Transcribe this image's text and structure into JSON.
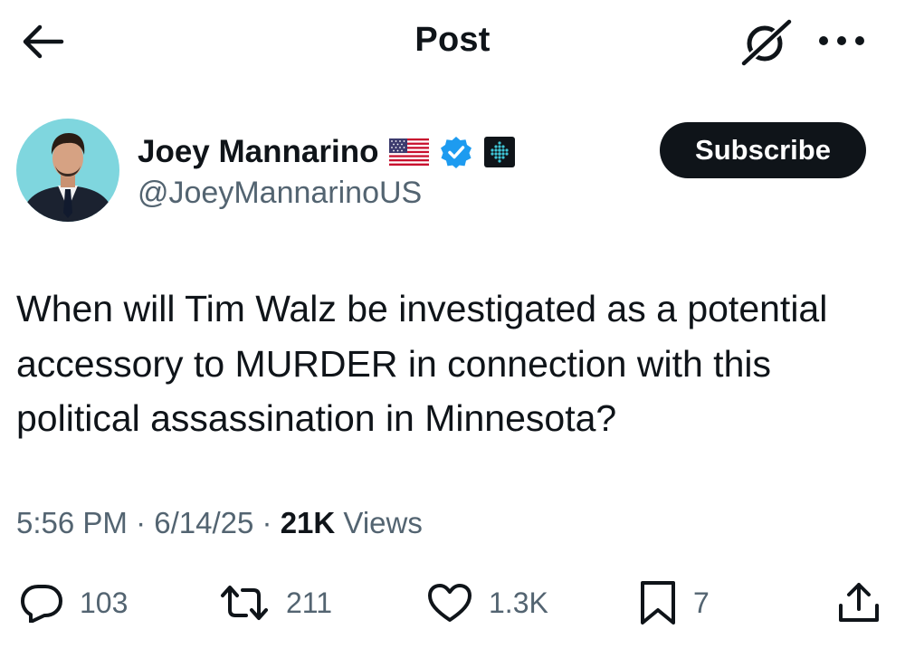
{
  "header": {
    "title": "Post",
    "back_icon": "arrow-left-icon",
    "grok_icon": "grok-icon",
    "more_icon": "more-horizontal-icon"
  },
  "author": {
    "name": "Joey Mannarino",
    "handle": "@JoeyMannarinoUS",
    "badges": [
      "us-flag-icon",
      "verified-badge-icon",
      "affiliate-badge-icon"
    ],
    "verified_color": "#1d9bf0"
  },
  "subscribe_label": "Subscribe",
  "tweet": {
    "text": "When will Tim Walz be investigated as a potential accessory to MURDER in connection with this political assassination in Minnesota?"
  },
  "meta": {
    "time": "5:56 PM",
    "separator": "·",
    "date": "6/14/25",
    "views_count": "21K",
    "views_label": "Views"
  },
  "actions": {
    "replies": "103",
    "reposts": "211",
    "likes": "1.3K",
    "bookmarks": "7"
  },
  "colors": {
    "text": "#0f1419",
    "secondary": "#536471",
    "subscribe_bg": "#0f1419"
  }
}
